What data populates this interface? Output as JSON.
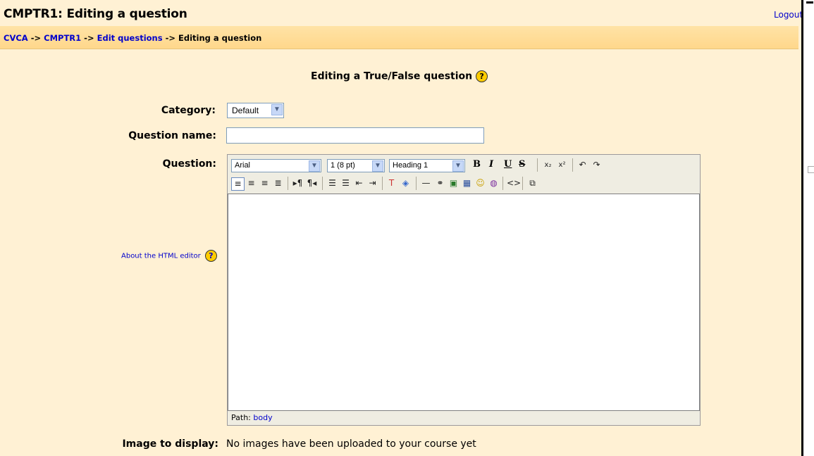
{
  "header": {
    "title": "CMPTR1: Editing a question",
    "logout": "Logout"
  },
  "breadcrumb": {
    "c1": "CVCA",
    "sep1": "->",
    "c2": "CMPTR1",
    "sep2": "->",
    "c3": "Edit questions",
    "sep3": "->",
    "c4": "Editing a question"
  },
  "form": {
    "heading": "Editing a True/False question",
    "help": "?",
    "category_label": "Category:",
    "category_value": "Default",
    "question_name_label": "Question name:",
    "question_name_value": "",
    "question_label": "Question:",
    "about_editor": "About the HTML editor",
    "image_label": "Image to display:",
    "image_value": "No images have been uploaded to your course yet"
  },
  "editor": {
    "font": "Arial",
    "size": "1 (8 pt)",
    "format": "Heading 1",
    "path_label": "Path:",
    "path_value": "body",
    "buttons": {
      "bold": "B",
      "italic": "I",
      "underline": "U",
      "strike": "S"
    }
  }
}
